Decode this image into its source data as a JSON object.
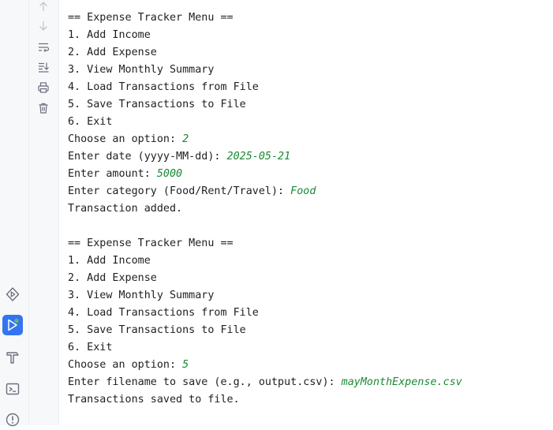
{
  "sidebar": {
    "icons": [
      "services-icon",
      "run-icon",
      "build-icon",
      "terminal-icon",
      "problems-icon"
    ]
  },
  "console_toolbar": {
    "icons": [
      "scroll-up-icon",
      "scroll-down-icon",
      "soft-wrap-icon",
      "scroll-to-end-icon",
      "print-icon",
      "clear-all-icon"
    ]
  },
  "console": {
    "lines": [
      {
        "text": "== Expense Tracker Menu =="
      },
      {
        "text": "1. Add Income"
      },
      {
        "text": "2. Add Expense"
      },
      {
        "text": "3. View Monthly Summary"
      },
      {
        "text": "4. Load Transactions from File"
      },
      {
        "text": "5. Save Transactions to File"
      },
      {
        "text": "6. Exit"
      },
      {
        "text": "Choose an option: ",
        "input": "2"
      },
      {
        "text": "Enter date (yyyy-MM-dd): ",
        "input": "2025-05-21"
      },
      {
        "text": "Enter amount: ",
        "input": "5000"
      },
      {
        "text": "Enter category (Food/Rent/Travel): ",
        "input": "Food"
      },
      {
        "text": "Transaction added."
      },
      {
        "text": ""
      },
      {
        "text": "== Expense Tracker Menu =="
      },
      {
        "text": "1. Add Income"
      },
      {
        "text": "2. Add Expense"
      },
      {
        "text": "3. View Monthly Summary"
      },
      {
        "text": "4. Load Transactions from File"
      },
      {
        "text": "5. Save Transactions to File"
      },
      {
        "text": "6. Exit"
      },
      {
        "text": "Choose an option: ",
        "input": "5"
      },
      {
        "text": "Enter filename to save (e.g., output.csv): ",
        "input": "mayMonthExpense.csv"
      },
      {
        "text": "Transactions saved to file."
      }
    ]
  }
}
